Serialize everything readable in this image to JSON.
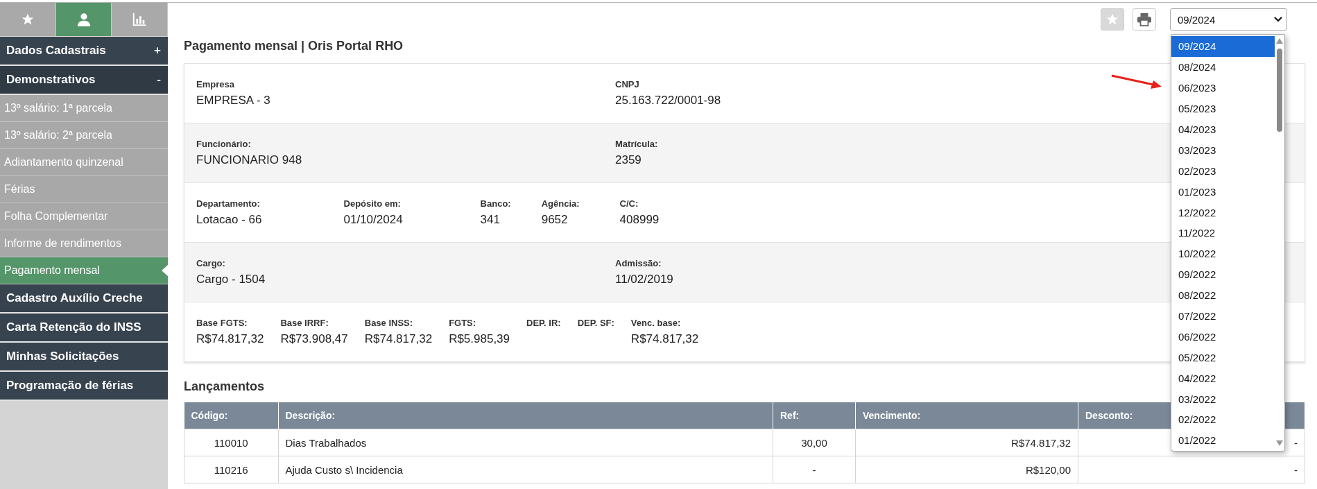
{
  "sidebar": {
    "tabs": [
      {
        "kind": "star",
        "selected": false
      },
      {
        "kind": "user",
        "selected": true
      },
      {
        "kind": "chart",
        "selected": false
      }
    ],
    "menu": [
      {
        "label": "Dados Cadastrais",
        "toggle": "+"
      },
      {
        "label": "Demonstrativos",
        "toggle": "-",
        "children": [
          {
            "label": "13º salário: 1ª parcela",
            "selected": false
          },
          {
            "label": "13º salário: 2ª parcela",
            "selected": false
          },
          {
            "label": "Adiantamento quinzenal",
            "selected": false
          },
          {
            "label": "Férias",
            "selected": false
          },
          {
            "label": "Folha Complementar",
            "selected": false
          },
          {
            "label": "Informe de rendimentos",
            "selected": false
          },
          {
            "label": "Pagamento mensal",
            "selected": true
          }
        ]
      },
      {
        "label": "Cadastro Auxílio Creche"
      },
      {
        "label": "Carta Retenção do INSS"
      },
      {
        "label": "Minhas Solicitações"
      },
      {
        "label": "Programação de férias"
      }
    ]
  },
  "toolbar": {
    "favorite": {
      "disabled": true
    },
    "print": {
      "disabled": false
    },
    "period_select": {
      "value": "09/2024",
      "options": [
        {
          "label": "09/2024",
          "selected": true
        },
        {
          "label": "08/2024",
          "selected": false
        },
        {
          "label": "06/2023",
          "selected": false
        },
        {
          "label": "05/2023",
          "selected": false
        },
        {
          "label": "04/2023",
          "selected": false
        },
        {
          "label": "03/2023",
          "selected": false
        },
        {
          "label": "02/2023",
          "selected": false
        },
        {
          "label": "01/2023",
          "selected": false
        },
        {
          "label": "12/2022",
          "selected": false
        },
        {
          "label": "11/2022",
          "selected": false
        },
        {
          "label": "10/2022",
          "selected": false
        },
        {
          "label": "09/2022",
          "selected": false
        },
        {
          "label": "08/2022",
          "selected": false
        },
        {
          "label": "07/2022",
          "selected": false
        },
        {
          "label": "06/2022",
          "selected": false
        },
        {
          "label": "05/2022",
          "selected": false
        },
        {
          "label": "04/2022",
          "selected": false
        },
        {
          "label": "03/2022",
          "selected": false
        },
        {
          "label": "02/2022",
          "selected": false
        },
        {
          "label": "01/2022",
          "selected": false
        }
      ]
    }
  },
  "title": "Pagamento mensal | Oris Portal RHO",
  "details": [
    {
      "kind": "wide",
      "fields": [
        {
          "label": "Empresa",
          "value": "EMPRESA - 3"
        },
        {
          "label": "CNPJ",
          "value": "25.163.722/0001-98"
        }
      ]
    },
    {
      "kind": "wide",
      "fields": [
        {
          "label": "Funcionário:",
          "value": "FUNCIONARIO 948"
        },
        {
          "label": "Matrícula:",
          "value": "2359"
        }
      ]
    },
    {
      "kind": "inline",
      "fields": [
        {
          "label": "Departamento:",
          "value": "Lotacao - 66"
        },
        {
          "label": "Depósito em:",
          "value": "01/10/2024"
        },
        {
          "label": "Banco:",
          "value": "341"
        },
        {
          "label": "Agência:",
          "value": "9652"
        },
        {
          "label": "C/C:",
          "value": "408999"
        }
      ]
    },
    {
      "kind": "wide",
      "fields": [
        {
          "label": "Cargo:",
          "value": "Cargo - 1504"
        },
        {
          "label": "Admissão:",
          "value": "11/02/2019"
        }
      ]
    },
    {
      "kind": "compact",
      "fields": [
        {
          "label": "Base FGTS:",
          "value": "R$74.817,32"
        },
        {
          "label": "Base IRRF:",
          "value": "R$73.908,47"
        },
        {
          "label": "Base INSS:",
          "value": "R$74.817,32"
        },
        {
          "label": "FGTS:",
          "value": "R$5.985,39"
        },
        {
          "label": "DEP. IR:"
        },
        {
          "label": "DEP. SF:"
        },
        {
          "label": "Venc. base:",
          "value": "R$74.817,32"
        }
      ]
    }
  ],
  "entries": {
    "title": "Lançamentos",
    "columns": [
      "Código:",
      "Descrição:",
      "Ref:",
      "Vencimento:",
      "Desconto:"
    ],
    "rows": [
      [
        "110010",
        "Dias Trabalhados",
        "30,00",
        "R$74.817,32",
        "-"
      ],
      [
        "110216",
        "Ajuda Custo s\\ Incidencia",
        "-",
        "R$120,00",
        "-"
      ]
    ]
  }
}
